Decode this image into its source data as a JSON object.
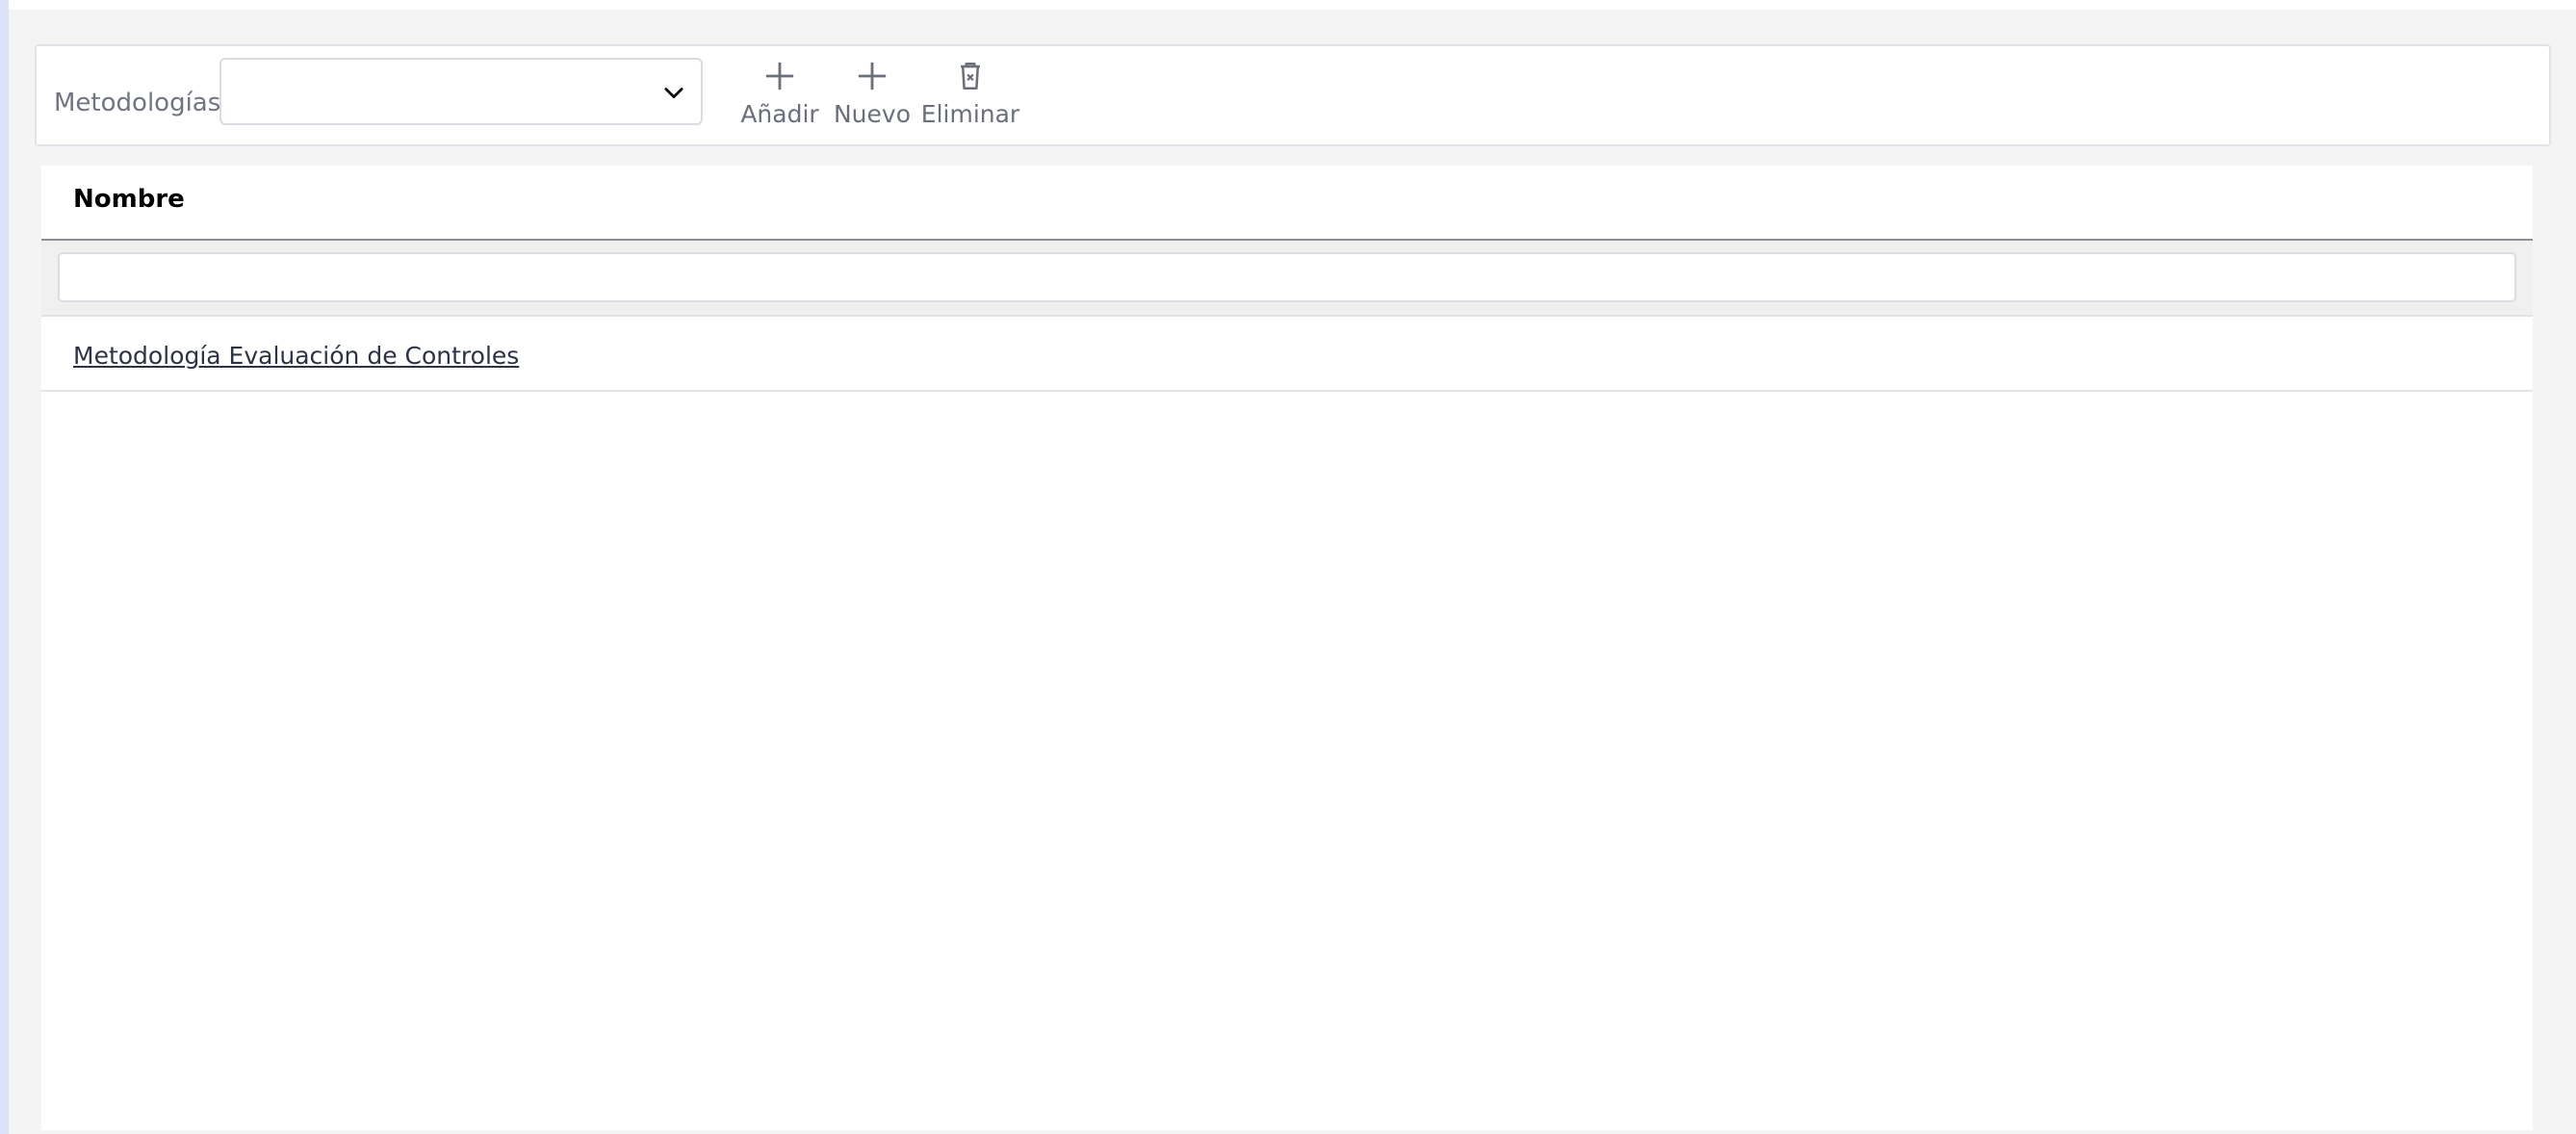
{
  "toolbar": {
    "label": "Metodologías",
    "select_value": "",
    "buttons": [
      {
        "label": "Añadir",
        "icon": "plus-icon"
      },
      {
        "label": "Nuevo",
        "icon": "plus-icon"
      },
      {
        "label": "Eliminar",
        "icon": "trash-icon"
      }
    ]
  },
  "grid": {
    "column_header": "Nombre",
    "filter_value": "",
    "rows": [
      {
        "nombre": "Metodología Evaluación de Controles"
      }
    ]
  }
}
